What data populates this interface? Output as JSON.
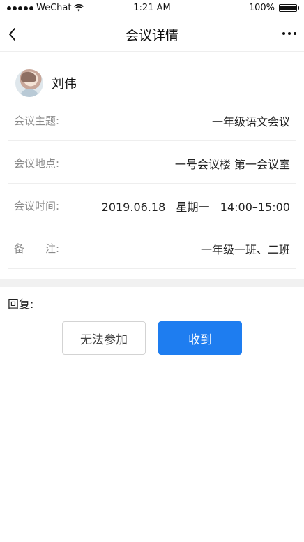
{
  "status_bar": {
    "carrier": "WeChat",
    "time": "1:21 AM",
    "battery": "100%",
    "icons": [
      "signal-dots-icon",
      "wifi-icon",
      "battery-icon"
    ]
  },
  "nav": {
    "title": "会议详情",
    "back_icon": "chevron-left-icon",
    "more_icon": "more-dots-icon"
  },
  "user": {
    "name": "刘伟"
  },
  "details": [
    {
      "label": "会议主题:",
      "value": "一年级语文会议"
    },
    {
      "label": "会议地点:",
      "value": "一号会议楼 第一会议室"
    },
    {
      "label": "会议时间:",
      "value": "2019.06.18   星期一   14:00–15:00"
    },
    {
      "label": "备　　注:",
      "value": "一年级一班、二班"
    }
  ],
  "reply": {
    "label": "回复:",
    "decline_label": "无法参加",
    "accept_label": "收到"
  },
  "colors": {
    "accent": "#1e7df0",
    "label_gray": "#8a8a8a",
    "band": "#f1f1f1"
  }
}
